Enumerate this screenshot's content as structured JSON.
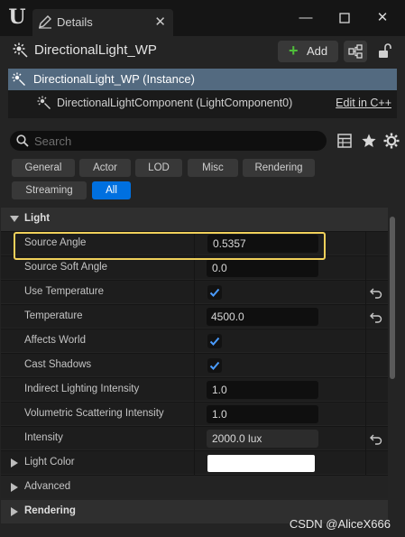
{
  "window": {
    "tab_title": "Details",
    "controls": [
      "minimize",
      "maximize",
      "close"
    ]
  },
  "header": {
    "actor_name": "DirectionalLight_WP",
    "add_label": "Add",
    "icons": [
      "directional-light-icon",
      "blueprint-icon",
      "lock-icon"
    ]
  },
  "tree": {
    "instance_label": "DirectionalLight_WP (Instance)",
    "component_label": "DirectionalLightComponent (LightComponent0)",
    "edit_link": "Edit in C++"
  },
  "search": {
    "placeholder": "Search"
  },
  "filters": {
    "items": [
      "General",
      "Actor",
      "LOD",
      "Misc",
      "Rendering",
      "Streaming",
      "All"
    ],
    "active": "All"
  },
  "sections": {
    "light": "Light",
    "light_color": "Light Color",
    "advanced": "Advanced",
    "rendering": "Rendering"
  },
  "properties": [
    {
      "name": "Source Angle",
      "type": "number",
      "value": "0.5357",
      "highlighted": true
    },
    {
      "name": "Source Soft Angle",
      "type": "number",
      "value": "0.0"
    },
    {
      "name": "Use Temperature",
      "type": "checkbox",
      "checked": true,
      "reset": true
    },
    {
      "name": "Temperature",
      "type": "number",
      "value": "4500.0",
      "reset": true
    },
    {
      "name": "Affects World",
      "type": "checkbox",
      "checked": true
    },
    {
      "name": "Cast Shadows",
      "type": "checkbox",
      "checked": true
    },
    {
      "name": "Indirect Lighting Intensity",
      "type": "number",
      "value": "1.0"
    },
    {
      "name": "Volumetric Scattering Intensity",
      "type": "number",
      "value": "1.0"
    },
    {
      "name": "Intensity",
      "type": "number",
      "value": "2000.0 lux",
      "reset": true
    }
  ],
  "light_color_value": "#ffffff",
  "colors": {
    "accent": "#0070e0",
    "selection": "#536a80",
    "highlight_box": "#f0d05a",
    "add_plus": "#4fbf3a"
  },
  "watermark": "CSDN @AliceX666"
}
